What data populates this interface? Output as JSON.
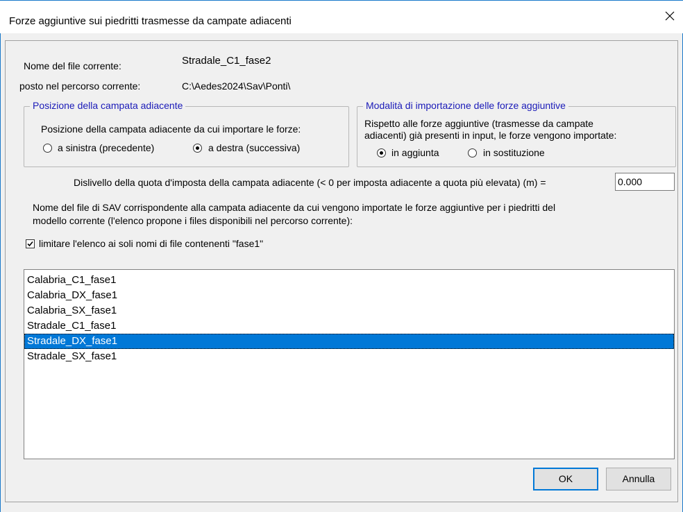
{
  "window": {
    "title": "Forze aggiuntive sui piedritti trasmesse da campate adiacenti"
  },
  "file_info": {
    "current_file_label": "Nome del file corrente:",
    "current_file_value": "Stradale_C1_fase2",
    "current_path_label": "posto nel percorso corrente:",
    "current_path_value": "C:\\Aedes2024\\Sav\\Ponti\\"
  },
  "position_group": {
    "title": "Posizione della campata adiacente",
    "prompt": "Posizione della campata adiacente da cui importare le forze:",
    "options": [
      {
        "label": "a sinistra (precedente)",
        "checked": false
      },
      {
        "label": "a destra (successiva)",
        "checked": true
      }
    ]
  },
  "import_mode_group": {
    "title": "Modalità di importazione delle forze aggiuntive",
    "prompt_line1": "Rispetto alle forze aggiuntive (trasmesse da campate",
    "prompt_line2": "adiacenti) già presenti in input, le forze vengono importate:",
    "options": [
      {
        "label": "in aggiunta",
        "checked": true
      },
      {
        "label": "in sostituzione",
        "checked": false
      }
    ]
  },
  "level_difference": {
    "label": "Dislivello della quota d'imposta della campata adiacente (< 0 per imposta adiacente a quota più elevata) (m) =",
    "value": "0.000"
  },
  "file_list_description": {
    "line1": "Nome del file di SAV corrispondente alla campata adiacente da cui vengono importate le forze aggiuntive per i piedritti del",
    "line2": "modello corrente (l'elenco propone i files disponibili nel percorso corrente):"
  },
  "filter_checkbox": {
    "label": "limitare l'elenco ai soli nomi di file contenenti \"fase1\"",
    "checked": true
  },
  "file_list": {
    "items": [
      "Calabria_C1_fase1",
      "Calabria_DX_fase1",
      "Calabria_SX_fase1",
      "Stradale_C1_fase1",
      "Stradale_DX_fase1",
      "Stradale_SX_fase1"
    ],
    "selected_index": 4
  },
  "buttons": {
    "ok": "OK",
    "cancel": "Annulla"
  }
}
